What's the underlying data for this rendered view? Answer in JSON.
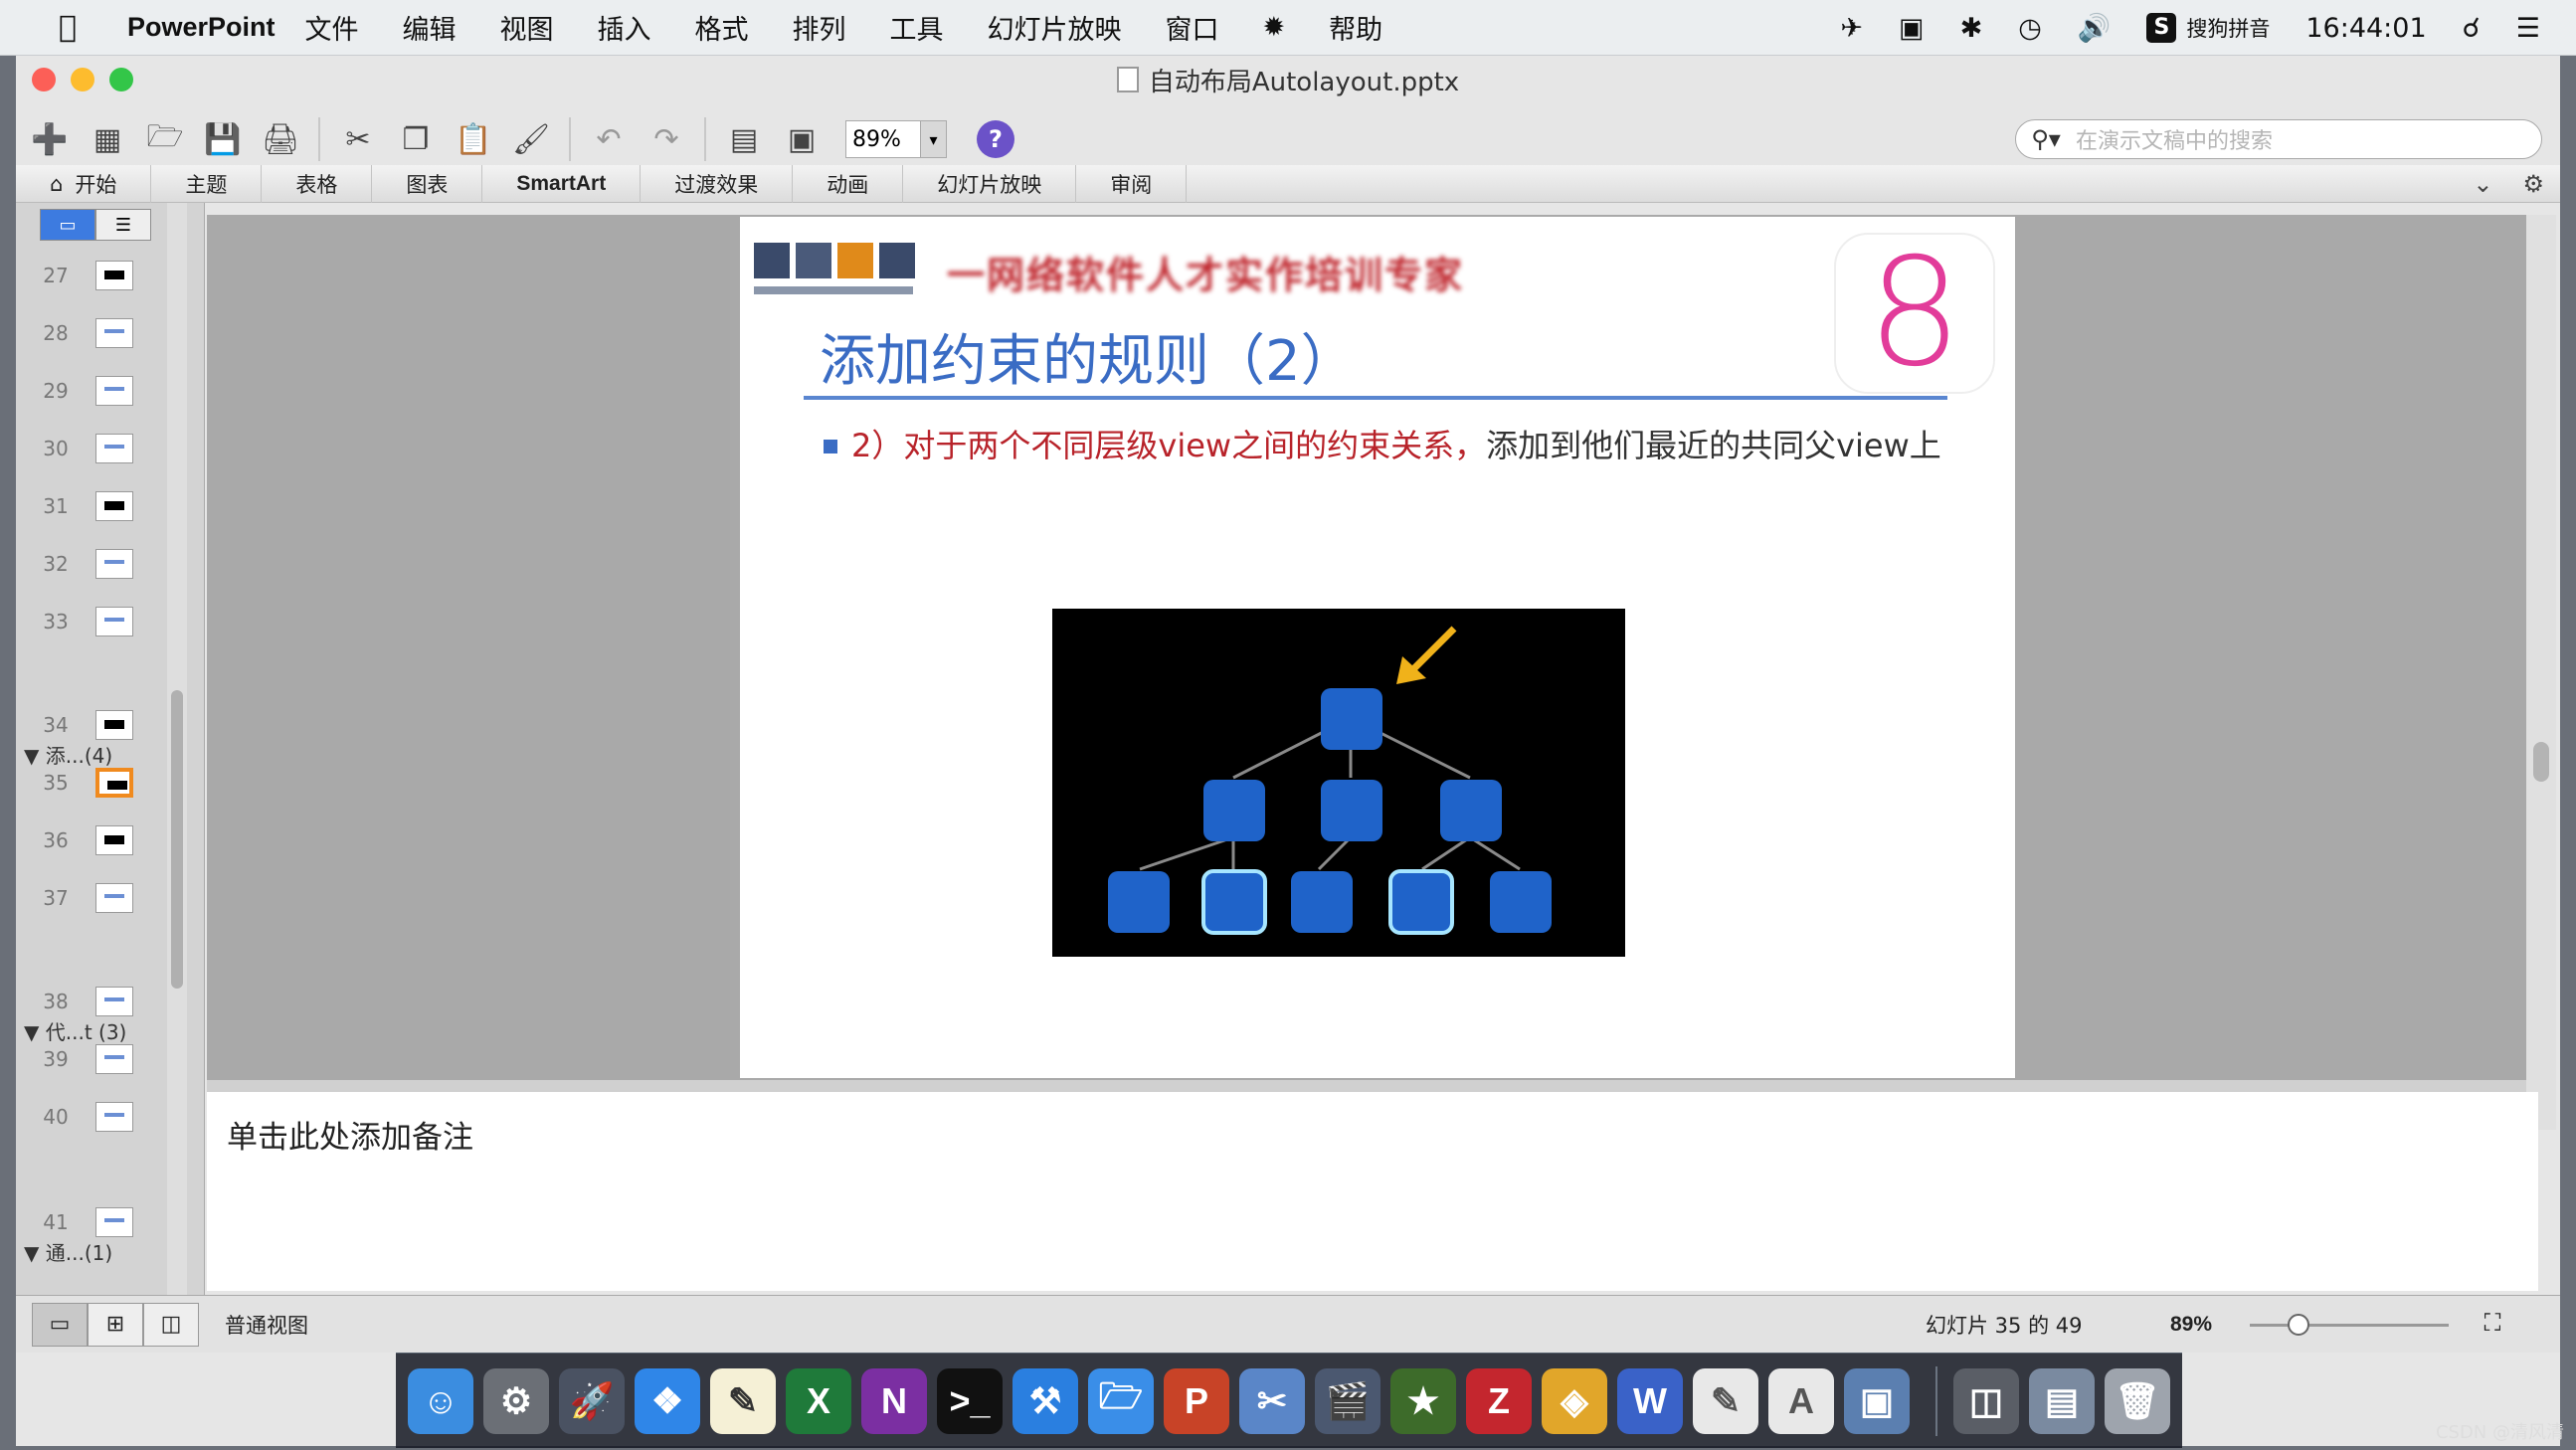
{
  "menubar": {
    "app_name": "PowerPoint",
    "items": [
      "文件",
      "编辑",
      "视图",
      "插入",
      "格式",
      "排列",
      "工具",
      "幻灯片放映",
      "窗口",
      "帮助"
    ],
    "input_method": "搜狗拼音",
    "clock": "16:44:01"
  },
  "window": {
    "title": "自动布局Autolayout.pptx"
  },
  "toolbar": {
    "zoom_value": "89%",
    "help_label": "?",
    "search_placeholder": "在演示文稿中的搜索"
  },
  "ribbon": {
    "tabs": [
      "开始",
      "主题",
      "表格",
      "图表",
      "SmartArt",
      "过渡效果",
      "动画",
      "幻灯片放映",
      "审阅"
    ]
  },
  "slides_panel": {
    "slide_numbers": [
      "27",
      "28",
      "29",
      "30",
      "31",
      "32",
      "33",
      "34",
      "35",
      "36",
      "37",
      "38",
      "39",
      "40",
      "41"
    ],
    "sections": [
      "添...(4)",
      "代...t (3)",
      "通...(1)"
    ],
    "selected_slide": "35"
  },
  "slide": {
    "title": "添加约束的规则（2）",
    "banner": "一网络软件人才实作培训专家",
    "bullet_number": "2）",
    "bullet_red": "对于两个不同层级view之间的约束关系，",
    "bullet_rest": "添加到他们最近的共同父view上",
    "badge_text": "8"
  },
  "notes": {
    "placeholder": "单击此处添加备注"
  },
  "statusbar": {
    "view_name": "普通视图",
    "slide_counter": "幻灯片 35 的 49",
    "zoom": "89%"
  },
  "watermark": "CSDN @清风清",
  "colors": {
    "title_blue": "#3a6cc4",
    "accent_red": "#b8232a",
    "node_blue": "#1f63c9",
    "selected_thumb": "#f08a1e"
  }
}
